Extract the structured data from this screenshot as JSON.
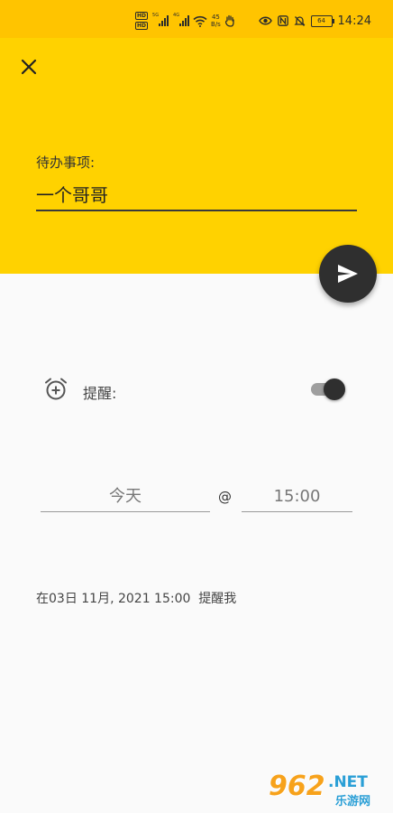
{
  "status_bar": {
    "hd_label": "HD",
    "network_5g": "5G",
    "network_4g": "4G",
    "speed_value": "45",
    "speed_unit": "B/s",
    "battery_level": "64",
    "time": "14:24"
  },
  "header": {
    "close_icon": "close-icon",
    "todo_label": "待办事项:",
    "todo_value": "一个哥哥"
  },
  "send_button": {
    "icon": "send-icon"
  },
  "reminder": {
    "alarm_icon": "alarm-add-icon",
    "label": "提醒:",
    "enabled": true
  },
  "schedule": {
    "date_text": "今天",
    "at_symbol": "@",
    "time_text": "15:00"
  },
  "summary": {
    "text": "在03日 11月, 2021 15:00  提醒我"
  },
  "watermark": {
    "number": "962",
    "suffix": ".NET",
    "chinese": "乐游网"
  },
  "colors": {
    "status_bar": "#ffc400",
    "header": "#ffd200",
    "fab": "#2f2f2f",
    "background": "#fafafa"
  }
}
